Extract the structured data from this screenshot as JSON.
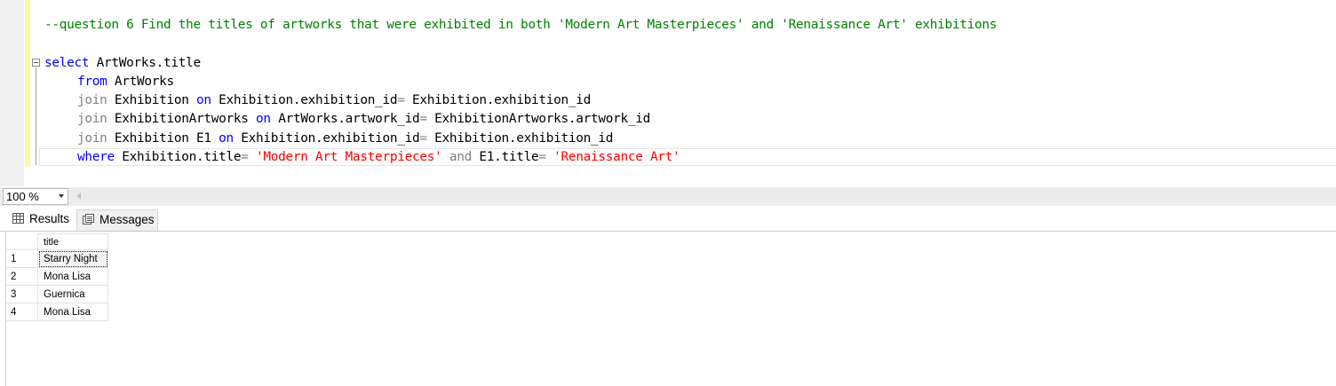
{
  "editor": {
    "comment": "--question 6 Find the titles of artworks that were exhibited in both 'Modern Art Masterpieces' and 'Renaissance Art' exhibitions",
    "lines": [
      {
        "kw1": "select",
        "rest": " ArtWorks.title"
      },
      {
        "kw1": "from",
        "rest": " ArtWorks"
      },
      {
        "kw1": "join",
        "t1": " Exhibition ",
        "kw2": "on",
        "t2": " Exhibition.exhibition_id",
        "op": "=",
        "t3": " Exhibition.exhibition_id"
      },
      {
        "kw1": "join",
        "t1": " ExhibitionArtworks ",
        "kw2": "on",
        "t2": " ArtWorks.artwork_id",
        "op": "=",
        "t3": " ExhibitionArtworks.artwork_id"
      },
      {
        "kw1": "join",
        "t1": " Exhibition E1 ",
        "kw2": "on",
        "t2": " Exhibition.exhibition_id",
        "op": "=",
        "t3": " Exhibition.exhibition_id"
      },
      {
        "kw1": "where",
        "t1": " Exhibition.title",
        "op1": "=",
        "s1": " 'Modern Art Masterpieces'",
        "kw2": " and",
        "t2": " E1.title",
        "op2": "=",
        "s2": " 'Renaissance Art'"
      }
    ]
  },
  "zoom": {
    "value": "100 %"
  },
  "tabs": {
    "results": "Results",
    "messages": "Messages"
  },
  "grid": {
    "column": "title",
    "rows": [
      {
        "num": "1",
        "title": "Starry Night"
      },
      {
        "num": "2",
        "title": "Mona Lisa"
      },
      {
        "num": "3",
        "title": "Guernica"
      },
      {
        "num": "4",
        "title": "Mona Lisa"
      }
    ]
  },
  "colors": {
    "keyword": "#0000ff",
    "string": "#ff0000",
    "comment": "#008000",
    "operator": "#808080"
  }
}
